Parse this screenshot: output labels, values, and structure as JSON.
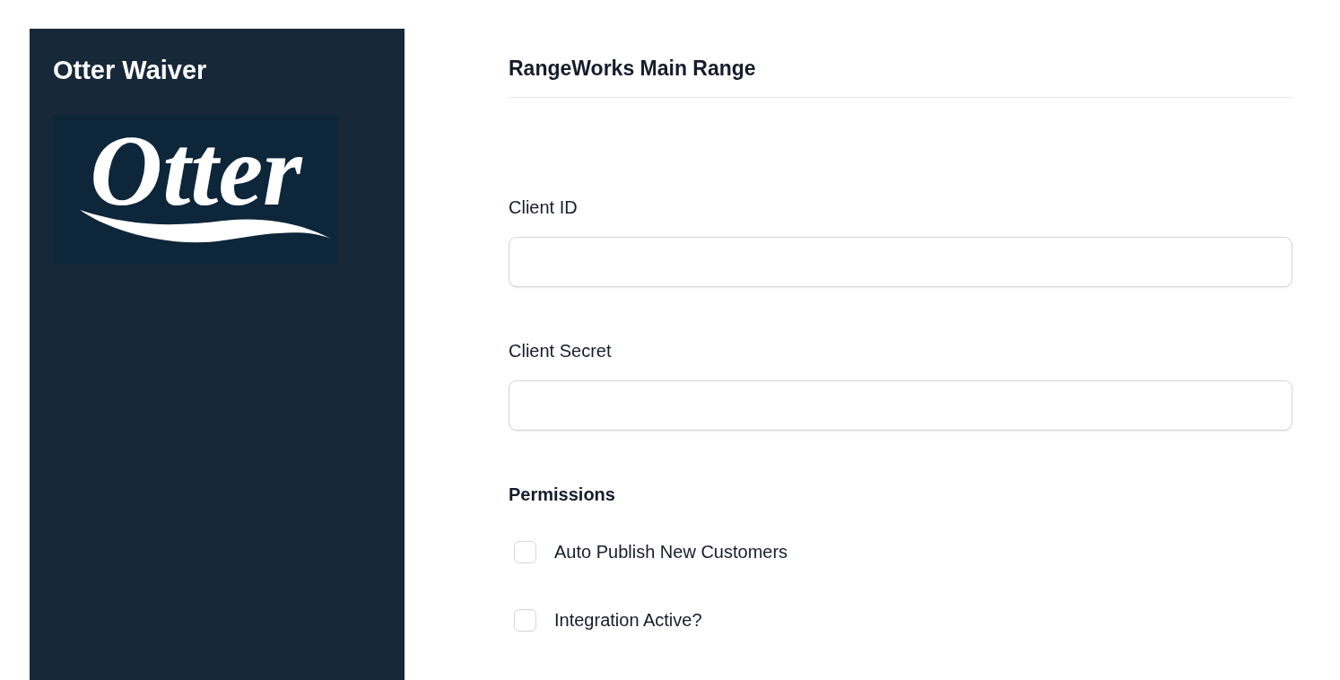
{
  "sidebar": {
    "title": "Otter Waiver",
    "logo": {
      "text": "Otter"
    }
  },
  "main": {
    "heading": "RangeWorks Main Range",
    "fields": [
      {
        "label": "Client ID"
      },
      {
        "label": "Client Secret"
      }
    ],
    "permissions": {
      "title": "Permissions",
      "items": [
        {
          "label": "Auto Publish New Customers",
          "checked": false
        },
        {
          "label": "Integration Active?",
          "checked": false
        }
      ]
    }
  }
}
